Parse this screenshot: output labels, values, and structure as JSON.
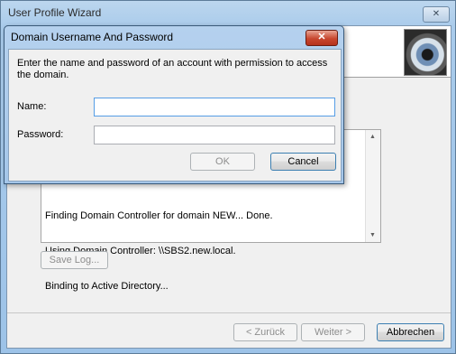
{
  "wizard": {
    "title": "User Profile Wizard",
    "close_glyph": "✕",
    "log_lines": [
      "Finding Domain Controller for domain NEW... Done.",
      "Using Domain Controller: \\\\SBS2.new.local.",
      "Binding to Active Directory..."
    ],
    "save_log_label": "Save Log...",
    "back_label": "< Zurück",
    "next_label": "Weiter >",
    "cancel_label": "Abbrechen"
  },
  "dialog": {
    "title": "Domain Username And Password",
    "close_glyph": "✕",
    "message": "Enter the name and password of an account with permission to access the domain.",
    "name_label": "Name:",
    "name_value": "",
    "password_label": "Password:",
    "password_value": "",
    "ok_label": "OK",
    "cancel_label": "Cancel"
  },
  "colors": {
    "title_bar": "#a9cbeb",
    "close_button_red": "#c8472f",
    "focus_border": "#569de5"
  },
  "icons": {
    "header_image": "eye-image",
    "scroll_up": "scroll-up-arrow-icon",
    "scroll_down": "scroll-down-arrow-icon"
  }
}
